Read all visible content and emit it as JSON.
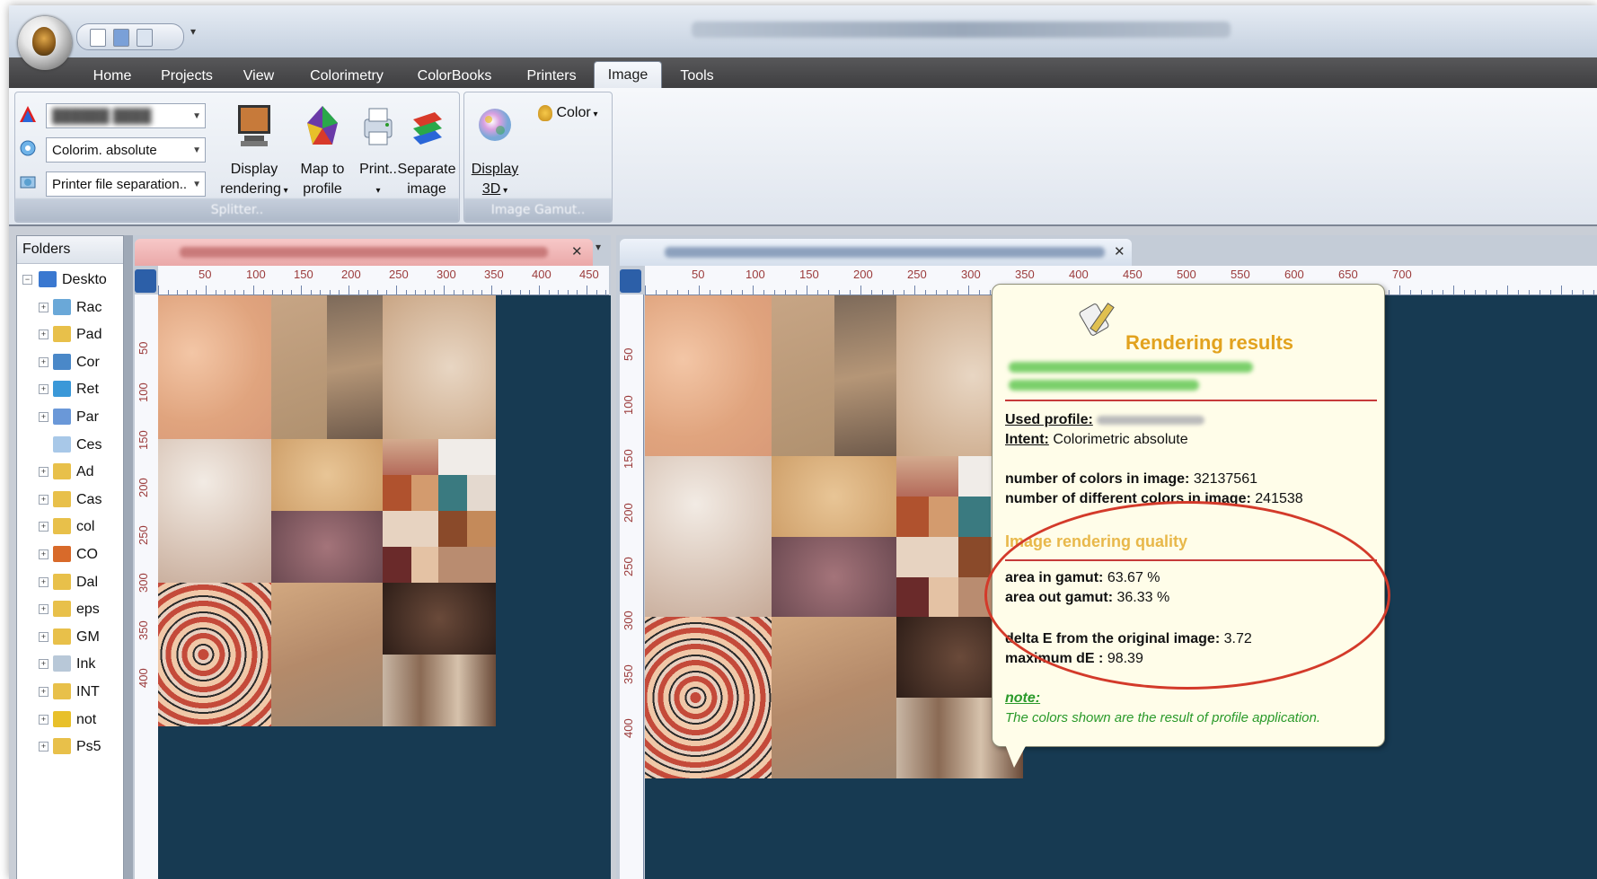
{
  "tabs": [
    {
      "label": "Home"
    },
    {
      "label": "Projects"
    },
    {
      "label": "View"
    },
    {
      "label": "Colorimetry"
    },
    {
      "label": "ColorBooks"
    },
    {
      "label": "Printers"
    },
    {
      "label": "Image"
    },
    {
      "label": "Tools"
    }
  ],
  "active_tab": "Image",
  "ribbon": {
    "splitter": {
      "combo_intent": "Colorim. absolute",
      "combo_separation": "Printer file separation..",
      "display_rendering": "Display\nrendering",
      "map_to_profile": "Map to\nprofile",
      "print": "Print..",
      "separate_image": "Separate\nimage",
      "group_label": "Splitter.."
    },
    "gamut": {
      "display_3d": "Display\n3D",
      "color": "Color",
      "group_label": "Image Gamut.."
    }
  },
  "folders": {
    "header": "Folders",
    "items": [
      {
        "label": "Deskto",
        "icon": "desktop-icon"
      },
      {
        "label": "Rac",
        "icon": "recycle-bin-icon"
      },
      {
        "label": "Pad",
        "icon": "folder-icon"
      },
      {
        "label": "Cor",
        "icon": "control-panel-icon"
      },
      {
        "label": "Ret",
        "icon": "network-icon"
      },
      {
        "label": "Par",
        "icon": "shared-folder-icon"
      },
      {
        "label": "Ces",
        "icon": "recycle-icon"
      },
      {
        "label": "Ad",
        "icon": "folder-icon"
      },
      {
        "label": "Cas",
        "icon": "folder-icon"
      },
      {
        "label": "col",
        "icon": "folder-icon"
      },
      {
        "label": "CO",
        "icon": "globe-icon"
      },
      {
        "label": "Dal",
        "icon": "folder-icon"
      },
      {
        "label": "eps",
        "icon": "folder-icon"
      },
      {
        "label": "GM",
        "icon": "folder-icon"
      },
      {
        "label": "Ink",
        "icon": "ink-icon"
      },
      {
        "label": "INT",
        "icon": "folder-icon"
      },
      {
        "label": "not",
        "icon": "warning-icon"
      },
      {
        "label": "Ps5",
        "icon": "folder-icon"
      }
    ]
  },
  "ruler_left_panel": [
    "50",
    "100",
    "150",
    "200",
    "250",
    "300",
    "350",
    "400",
    "450"
  ],
  "ruler_right_panel": [
    "50",
    "100",
    "150",
    "200",
    "250",
    "300",
    "350",
    "400",
    "450",
    "500",
    "550",
    "600",
    "650",
    "700"
  ],
  "ruler_vertical": [
    "50",
    "100",
    "150",
    "200",
    "250",
    "300",
    "350",
    "400"
  ],
  "popup": {
    "title": "Rendering results",
    "used_profile_label": "Used profile:",
    "intent_label": "Intent:",
    "intent_value": "Colorimetric absolute",
    "num_colors_label": "number of colors in image:",
    "num_colors_value": "32137561",
    "num_diff_colors_label": "number of different colors in image:",
    "num_diff_colors_value": "241538",
    "quality_heading": "Image rendering quality",
    "area_in_label": "area in gamut:",
    "area_in_value": "63.67 %",
    "area_out_label": "area out gamut:",
    "area_out_value": "36.33 %",
    "delta_e_label": "delta E from the original image:",
    "delta_e_value": "3.72",
    "max_de_label": "maximum dE :",
    "max_de_value": "98.39",
    "note_label": "note:",
    "note_text": "The colors shown are the result of profile application."
  },
  "colors": {
    "tab_bar": "#4a4a4c",
    "canvas_bg": "#173a52",
    "popup_bg": "#fffde9",
    "highlight_ellipse": "#d33a2a",
    "title_orange": "#e2a21e",
    "note_green": "#2a9a2a"
  }
}
